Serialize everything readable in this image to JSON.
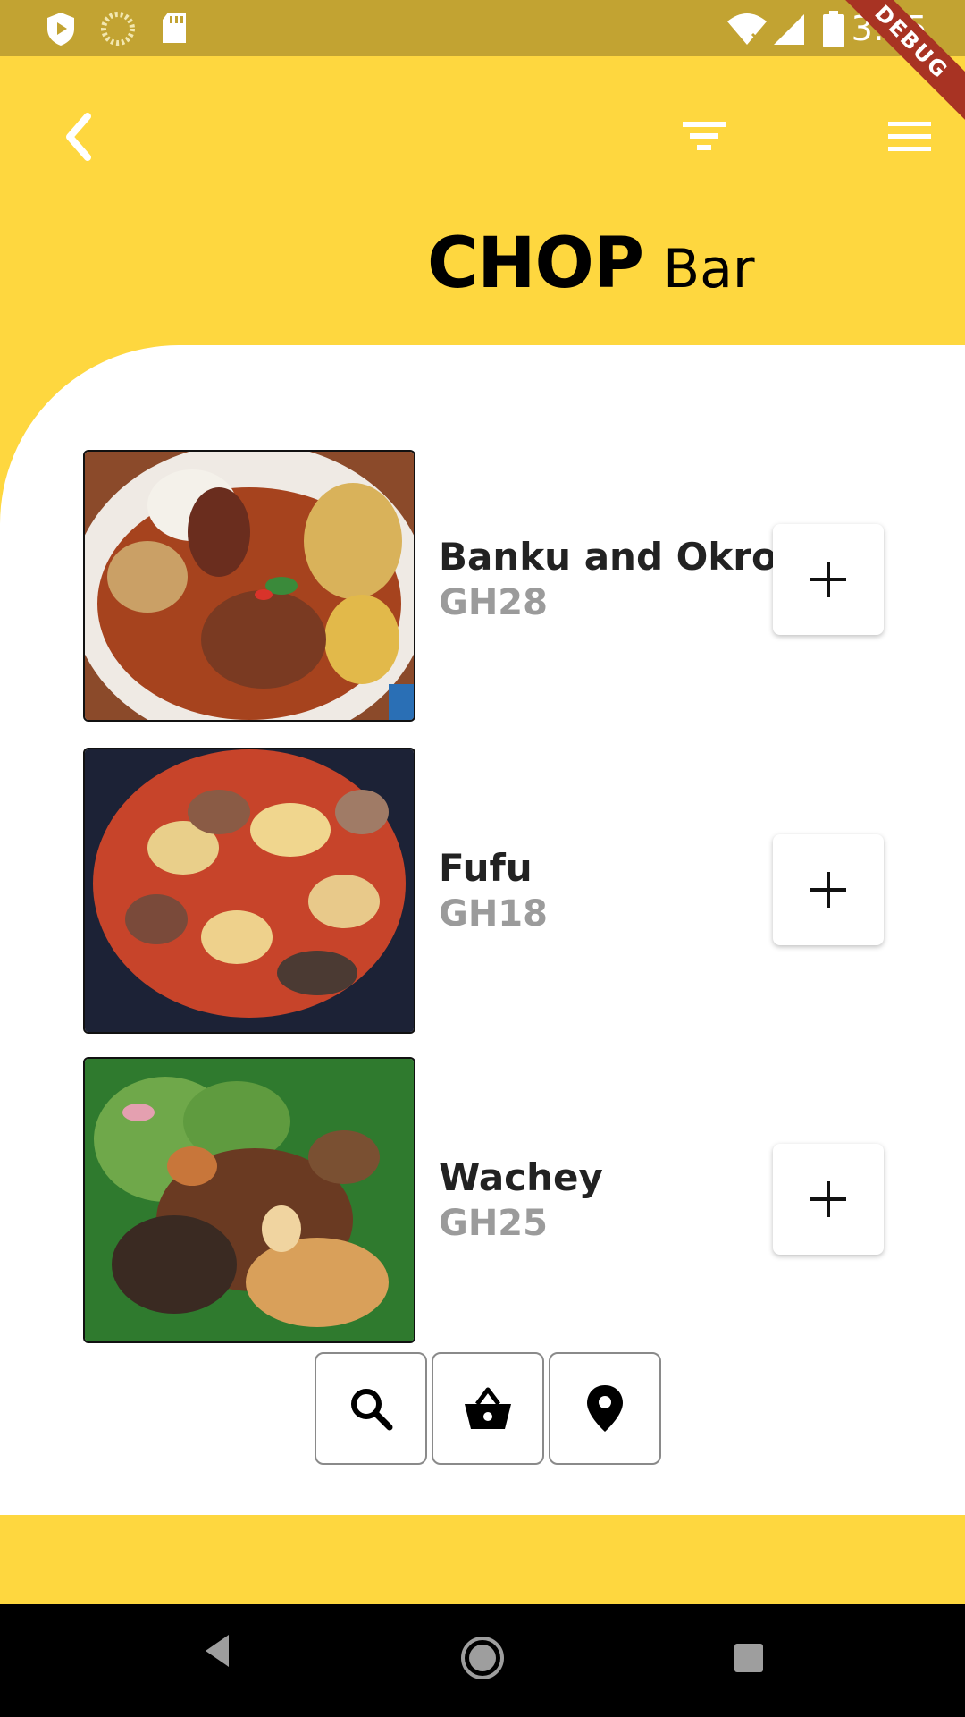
{
  "status_bar": {
    "time": "3:25",
    "debug_label": "DEBUG",
    "icons": [
      "play-protect-icon",
      "sync-icon",
      "sd-card-icon",
      "wifi-icon",
      "signal-icon",
      "battery-icon"
    ]
  },
  "app_bar": {
    "back_icon": "chevron-left-icon",
    "filter_icon": "filter-icon",
    "menu_icon": "hamburger-menu-icon"
  },
  "header": {
    "title_bold": "CHOP",
    "title_regular": "Bar"
  },
  "menu_items": [
    {
      "name": "Banku and Okro",
      "price": "GH28",
      "add_icon": "plus-icon"
    },
    {
      "name": "Fufu",
      "price": "GH18",
      "add_icon": "plus-icon"
    },
    {
      "name": "Wachey",
      "price": "GH25",
      "add_icon": "plus-icon"
    }
  ],
  "bottom_actions": [
    {
      "icon": "search-icon"
    },
    {
      "icon": "basket-icon"
    },
    {
      "icon": "location-pin-icon"
    }
  ],
  "colors": {
    "accent": "#fed73f",
    "status_bar": "#c2a332",
    "price": "#9b9b9b",
    "debug": "#a83323"
  }
}
